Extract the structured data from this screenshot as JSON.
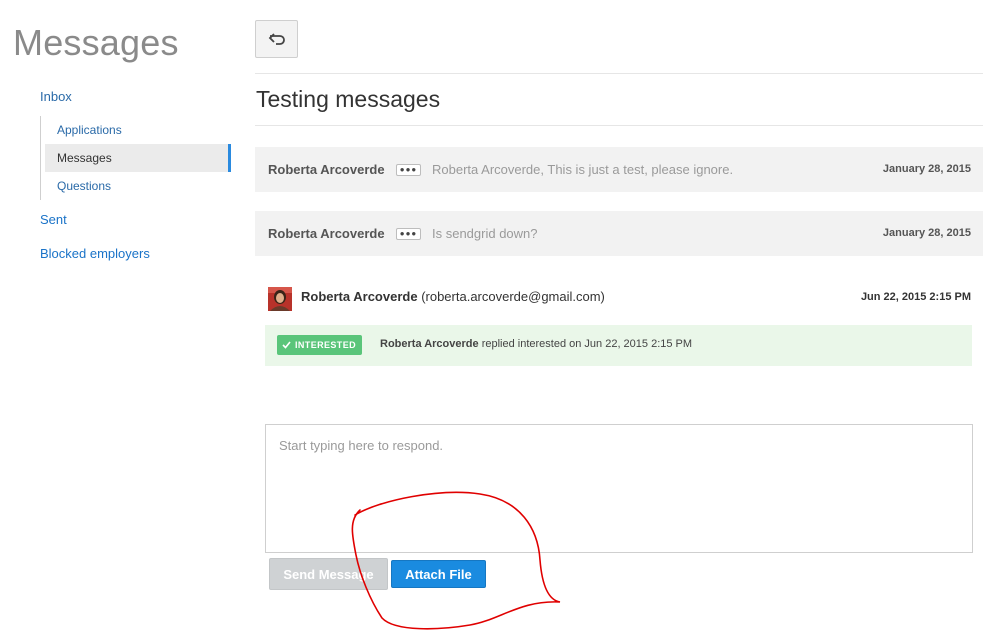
{
  "page_title": "Messages",
  "sidebar": {
    "inbox": "Inbox",
    "subitems": [
      {
        "label": "Applications"
      },
      {
        "label": "Messages",
        "active": true
      },
      {
        "label": "Questions"
      }
    ],
    "sent": "Sent",
    "blocked": "Blocked employers"
  },
  "thread": {
    "back_icon": "back-arrow-icon",
    "title": "Testing messages",
    "collapsed_messages": [
      {
        "sender": "Roberta Arcoverde",
        "preview": "Roberta Arcoverde, This is just a test, please ignore.",
        "date": "January 28, 2015",
        "more_icon": "ellipsis-icon"
      },
      {
        "sender": "Roberta Arcoverde",
        "preview": "Is sendgrid down?",
        "date": "January 28, 2015",
        "more_icon": "ellipsis-icon"
      }
    ],
    "open_message": {
      "sender": "Roberta Arcoverde",
      "email": "(roberta.arcoverde@gmail.com)",
      "date": "Jun 22, 2015 2:15 PM",
      "status_badge": "INTERESTED",
      "status_sender": "Roberta Arcoverde",
      "status_text": "replied interested on Jun 22, 2015 2:15 PM"
    }
  },
  "reply": {
    "placeholder": "Start typing here to respond.",
    "value": "",
    "send_label": "Send Message",
    "attach_label": "Attach File"
  },
  "colors": {
    "link": "#1a73c8",
    "active_indicator": "#2a8adf",
    "badge_green": "#5ac57a",
    "notice_bg": "#eaf7e9",
    "primary_button": "#1a8be0",
    "disabled_button": "#cfd2d4",
    "annotation": "#e00000"
  }
}
